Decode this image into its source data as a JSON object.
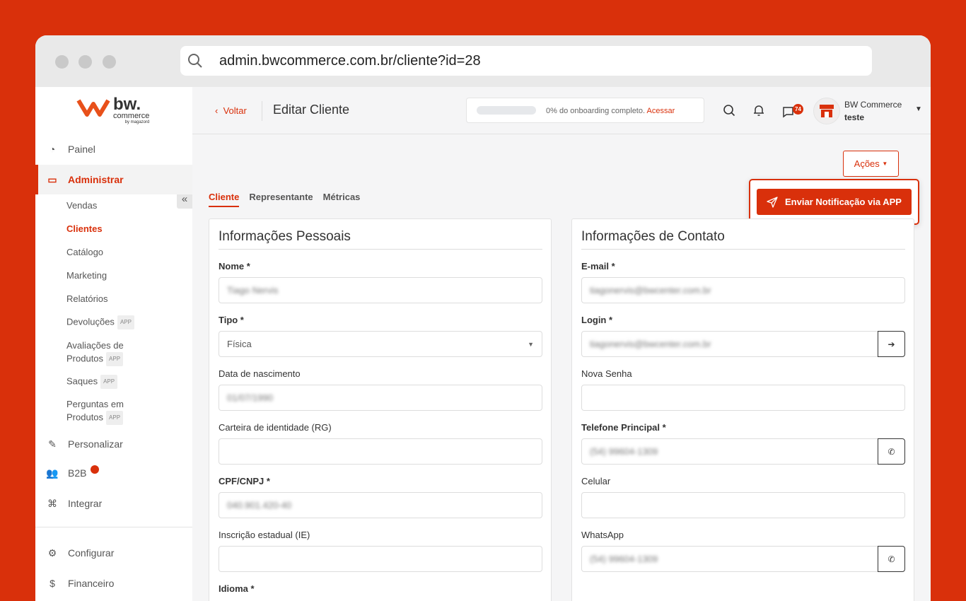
{
  "browser": {
    "url": "admin.bwcommerce.com.br/cliente?id=28"
  },
  "logo": {
    "brand": "bw.",
    "sub": "commerce",
    "by": "by magazord"
  },
  "sidebar": {
    "items": [
      {
        "label": "Painel"
      },
      {
        "label": "Administrar"
      },
      {
        "label": "Personalizar"
      },
      {
        "label": "B2B"
      },
      {
        "label": "Integrar"
      },
      {
        "label": "Configurar"
      },
      {
        "label": "Financeiro"
      }
    ],
    "sub": [
      {
        "label": "Vendas"
      },
      {
        "label": "Clientes"
      },
      {
        "label": "Catálogo"
      },
      {
        "label": "Marketing"
      },
      {
        "label": "Relatórios"
      },
      {
        "label": "Devoluções",
        "badge": "APP"
      },
      {
        "label": "Avaliações de Produtos",
        "badge": "APP"
      },
      {
        "label": "Saques",
        "badge": "APP"
      },
      {
        "label": "Perguntas em Produtos",
        "badge": "APP"
      }
    ]
  },
  "header": {
    "back": "Voltar",
    "title": "Editar Cliente",
    "onboarding": "0% do onboarding completo.",
    "onboarding_link": "Acessar",
    "onboarding_progress": 0,
    "messages_count": "74",
    "user_name": "BW Commerce",
    "user_store": "teste"
  },
  "actions": {
    "label": "Ações",
    "send_notification": "Enviar Notificação via APP"
  },
  "tabs": [
    "Cliente",
    "Representante",
    "Métricas"
  ],
  "personal": {
    "title": "Informações Pessoais",
    "fields": [
      {
        "label": "Nome *",
        "value": "Tiago Nervis"
      },
      {
        "label": "Tipo *",
        "value": "Física"
      },
      {
        "label": "Data de nascimento",
        "value": "01/07/1990"
      },
      {
        "label": "Carteira de identidade (RG)",
        "value": ""
      },
      {
        "label": "CPF/CNPJ *",
        "value": "040.901.420-40"
      },
      {
        "label": "Inscrição estadual (IE)",
        "value": ""
      },
      {
        "label": "Idioma *",
        "value": ""
      }
    ]
  },
  "contact": {
    "title": "Informações de Contato",
    "fields": [
      {
        "label": "E-mail *",
        "value": "tiagonervis@bwcenter.com.br"
      },
      {
        "label": "Login *",
        "value": "tiagonervis@bwcenter.com.br"
      },
      {
        "label": "Nova Senha",
        "value": ""
      },
      {
        "label": "Telefone Principal *",
        "value": "(54) 99604-1309"
      },
      {
        "label": "Celular",
        "value": ""
      },
      {
        "label": "WhatsApp",
        "value": "(54) 99604-1309"
      }
    ]
  },
  "colors": {
    "accent": "#d9300b"
  }
}
